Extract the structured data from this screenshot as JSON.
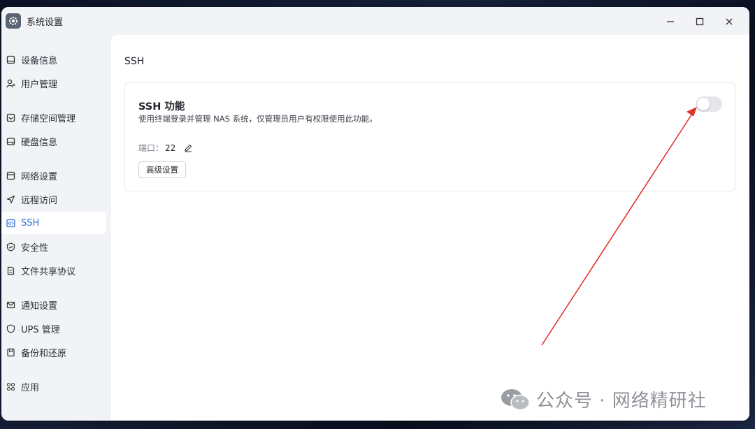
{
  "window": {
    "title": "系统设置",
    "app_icon": "gear-icon"
  },
  "sidebar": {
    "items": [
      {
        "label": "设备信息",
        "icon": "monitor-icon"
      },
      {
        "label": "用户管理",
        "icon": "user-icon"
      },
      {
        "label": "存储空间管理",
        "icon": "storage-icon"
      },
      {
        "label": "硬盘信息",
        "icon": "disk-icon"
      },
      {
        "label": "网络设置",
        "icon": "network-icon"
      },
      {
        "label": "远程访问",
        "icon": "send-icon"
      },
      {
        "label": "SSH",
        "icon": "code-icon",
        "active": true
      },
      {
        "label": "安全性",
        "icon": "shield-check-icon"
      },
      {
        "label": "文件共享协议",
        "icon": "document-icon"
      },
      {
        "label": "通知设置",
        "icon": "mail-icon"
      },
      {
        "label": "UPS 管理",
        "icon": "shield-icon"
      },
      {
        "label": "备份和还原",
        "icon": "backup-icon"
      },
      {
        "label": "应用",
        "icon": "apps-grid-icon"
      }
    ]
  },
  "main": {
    "section_title": "SSH",
    "card": {
      "title": "SSH 功能",
      "description": "使用终端登录并管理 NAS 系统，仅管理员用户有权限使用此功能。",
      "port_label": "端口：",
      "port_value": "22",
      "advanced_button": "高级设置",
      "toggle_enabled": false
    }
  },
  "watermark": {
    "text": "公众号 · 网络精研社"
  },
  "colors": {
    "accent": "#2f6fdd",
    "annotation_arrow": "#e0342b",
    "toggle_off": "#e4e6ea"
  }
}
